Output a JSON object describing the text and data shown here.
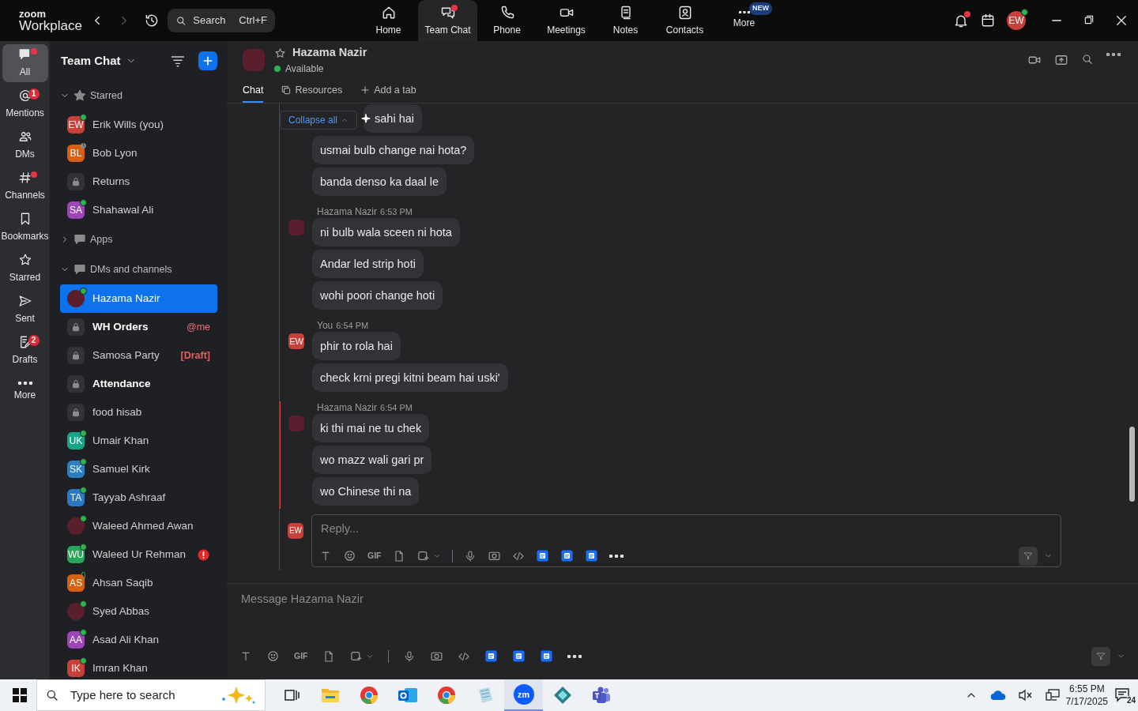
{
  "app": {
    "logo_top": "zoom",
    "logo_bottom": "Workplace",
    "search": {
      "placeholder": "Search",
      "shortcut": "Ctrl+F"
    }
  },
  "nav": [
    {
      "label": "Home",
      "selected": false,
      "dot": false
    },
    {
      "label": "Team Chat",
      "selected": true,
      "dot": true
    },
    {
      "label": "Phone",
      "selected": false,
      "dot": false
    },
    {
      "label": "Meetings",
      "selected": false,
      "dot": false
    },
    {
      "label": "Notes",
      "selected": false,
      "dot": false
    },
    {
      "label": "Contacts",
      "selected": false,
      "dot": false
    },
    {
      "label": "More",
      "selected": false,
      "dot": false,
      "badge": "NEW"
    }
  ],
  "user": {
    "initials": "EW",
    "color": "#c8403a",
    "online": true,
    "bell_dot": true
  },
  "rail": [
    {
      "label": "All",
      "selected": true,
      "dot": true
    },
    {
      "label": "Mentions",
      "selected": false,
      "dot": false,
      "badge": "1"
    },
    {
      "label": "DMs",
      "selected": false,
      "dot": false
    },
    {
      "label": "Channels",
      "selected": false,
      "dot": true
    },
    {
      "label": "Bookmarks",
      "selected": false,
      "dot": false
    },
    {
      "label": "Starred",
      "selected": false,
      "dot": false
    },
    {
      "label": "Sent",
      "selected": false,
      "dot": false
    },
    {
      "label": "Drafts",
      "selected": false,
      "dot": false,
      "badge": "2"
    },
    {
      "label": "More",
      "selected": false,
      "dot": false
    }
  ],
  "sidebar": {
    "title": "Team Chat",
    "sections": [
      {
        "label": "Starred",
        "kind": "star",
        "expanded": true,
        "items": [
          {
            "kind": "initials",
            "initials": "EW",
            "color": "#c8403a",
            "name": "Erik Wills (you)",
            "online": true,
            "bold": false,
            "selected": false
          },
          {
            "kind": "initials",
            "initials": "BL",
            "color": "#d9600f",
            "name": "Bob Lyon",
            "online": false,
            "away": true,
            "bold": false,
            "selected": false
          },
          {
            "kind": "channel",
            "name": "Returns",
            "bold": false,
            "selected": false
          },
          {
            "kind": "initials",
            "initials": "SA",
            "color": "#9b45b8",
            "name": "Shahawal Ali",
            "online": true,
            "bold": false,
            "selected": false
          }
        ]
      },
      {
        "label": "Apps",
        "kind": "bubble",
        "expanded": false
      },
      {
        "label": "DMs and channels",
        "kind": "bubble",
        "expanded": true,
        "items": [
          {
            "kind": "photo",
            "name": "Hazama Nazir",
            "online": true,
            "bold": false,
            "selected": true
          },
          {
            "kind": "channel",
            "name": "WH Orders",
            "bold": true,
            "selected": false,
            "tag": "@me"
          },
          {
            "kind": "channel",
            "name": "Samosa Party",
            "bold": false,
            "selected": false,
            "tag": "[Draft]"
          },
          {
            "kind": "channel",
            "name": "Attendance",
            "bold": true,
            "selected": false
          },
          {
            "kind": "channel",
            "name": "food hisab",
            "bold": false,
            "selected": false
          },
          {
            "kind": "initials",
            "initials": "UK",
            "color": "#17a589",
            "name": "Umair Khan",
            "online": true,
            "bold": false,
            "selected": false
          },
          {
            "kind": "initials",
            "initials": "SK",
            "color": "#2d7fc1",
            "name": "Samuel Kirk",
            "online": true,
            "bold": false,
            "selected": false
          },
          {
            "kind": "initials",
            "initials": "TA",
            "color": "#2a78c8",
            "name": "Tayyab Ashraaf",
            "online": true,
            "bold": false,
            "selected": false
          },
          {
            "kind": "photo",
            "name": "Waleed Ahmed Awan",
            "online": true,
            "bold": false,
            "selected": false
          },
          {
            "kind": "initials",
            "initials": "WU",
            "color": "#27a558",
            "name": "Waleed Ur Rehman",
            "online": true,
            "bold": false,
            "selected": false,
            "alert": true
          },
          {
            "kind": "initials",
            "initials": "AS",
            "color": "#d9600f",
            "name": "Ahsan Saqib",
            "online": false,
            "mobile": true,
            "bold": false,
            "selected": false
          },
          {
            "kind": "photo",
            "name": "Syed Abbas",
            "online": true,
            "bold": false,
            "selected": false
          },
          {
            "kind": "initials",
            "initials": "AA",
            "color": "#9b45b8",
            "name": "Asad Ali Khan",
            "online": true,
            "bold": false,
            "selected": false
          },
          {
            "kind": "initials",
            "initials": "IK",
            "color": "#c8403a",
            "name": "Imran Khan",
            "online": true,
            "bold": false,
            "selected": false
          }
        ]
      }
    ]
  },
  "chat": {
    "name": "Hazama Nazir",
    "status": "Available",
    "tabs": [
      {
        "label": "Chat",
        "selected": true
      },
      {
        "label": "Resources",
        "selected": false
      },
      {
        "label": "Add a tab",
        "selected": false
      }
    ],
    "collapse_label": "Collapse all",
    "groups": [
      {
        "kind": "continued",
        "highlighted": false,
        "messages": [
          "sahi hai",
          "usmai bulb change nai hota?",
          "banda denso ka daal le"
        ]
      },
      {
        "kind": "header",
        "sender": "Hazama Nazir",
        "time": "6:53 PM",
        "avatar": {
          "kind": "photo"
        },
        "highlighted": false,
        "messages": [
          "ni bulb wala sceen ni hota",
          "Andar led strip hoti",
          "wohi poori change hoti"
        ]
      },
      {
        "kind": "header",
        "sender": "You",
        "time": "6:54 PM",
        "avatar": {
          "kind": "initials",
          "initials": "EW",
          "color": "#c8403a"
        },
        "highlighted": false,
        "messages": [
          "phir to rola hai",
          "check krni pregi kitni beam hai uski'"
        ]
      },
      {
        "kind": "header",
        "sender": "Hazama Nazir",
        "time": "6:54 PM",
        "avatar": {
          "kind": "photo"
        },
        "highlighted": true,
        "messages": [
          "ki thi mai ne tu chek",
          "wo mazz wali gari pr",
          "wo Chinese thi na"
        ]
      }
    ],
    "reply": {
      "avatar": {
        "initials": "EW",
        "color": "#c8403a"
      },
      "placeholder": "Reply...",
      "gif_label": "GIF"
    },
    "composer": {
      "placeholder": "Message Hazama Nazir",
      "gif_label": "GIF"
    }
  },
  "taskbar": {
    "search_placeholder": "Type here to search",
    "app_label": "zm",
    "time": "6:55 PM",
    "date": "7/17/2025",
    "notifications": "24"
  }
}
